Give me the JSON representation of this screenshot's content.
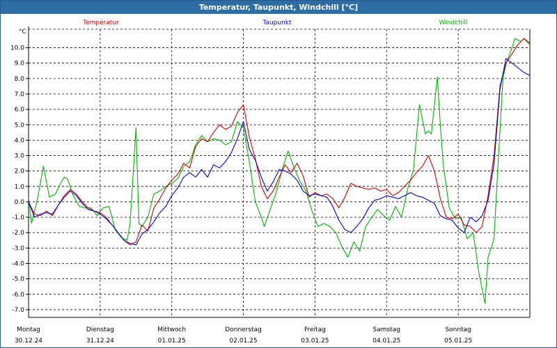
{
  "window": {
    "title": "Temperatur, Taupunkt, Windchill [°C]"
  },
  "chart_data": {
    "type": "line",
    "title": "Temperatur, Taupunkt, Windchill [°C]",
    "ylabel": "°C",
    "ylim": [
      -7.5,
      11.2
    ],
    "yticks": [
      "10.0",
      "9.0",
      "8.0",
      "7.0",
      "6.0",
      "5.0",
      "4.0",
      "3.0",
      "2.0",
      "1.0",
      "0.0",
      "-1.0",
      "-2.0",
      "-3.0",
      "-4.0",
      "-5.0",
      "-6.0",
      "-7.0"
    ],
    "xlim": [
      0,
      168
    ],
    "x_ticks": [
      {
        "x": 0,
        "day": "Montag",
        "date": "30.12.24"
      },
      {
        "x": 24,
        "day": "Dienstag",
        "date": "31.12.24"
      },
      {
        "x": 48,
        "day": "Mittwoch",
        "date": "01.01.25"
      },
      {
        "x": 72,
        "day": "Donnerstag",
        "date": "02.01.25"
      },
      {
        "x": 96,
        "day": "Freitag",
        "date": "03.01.25"
      },
      {
        "x": 120,
        "day": "Samstag",
        "date": "04.01.25"
      },
      {
        "x": 144,
        "day": "Sonntag",
        "date": "05.01.25"
      }
    ],
    "grid": true,
    "series": [
      {
        "name": "Temperatur",
        "color": "#d40000",
        "points": [
          [
            0,
            0.0
          ],
          [
            2,
            -0.8
          ],
          [
            4,
            -0.9
          ],
          [
            6,
            -0.6
          ],
          [
            8,
            -0.9
          ],
          [
            10,
            -0.2
          ],
          [
            12,
            0.4
          ],
          [
            14,
            0.8
          ],
          [
            16,
            0.5
          ],
          [
            18,
            0.0
          ],
          [
            20,
            -0.4
          ],
          [
            22,
            -0.6
          ],
          [
            24,
            -0.7
          ],
          [
            26,
            -1.0
          ],
          [
            28,
            -1.5
          ],
          [
            30,
            -2.0
          ],
          [
            32,
            -2.5
          ],
          [
            34,
            -2.8
          ],
          [
            36,
            -2.6
          ],
          [
            38,
            -1.5
          ],
          [
            40,
            -1.9
          ],
          [
            42,
            -0.4
          ],
          [
            44,
            0.2
          ],
          [
            46,
            0.9
          ],
          [
            48,
            1.4
          ],
          [
            50,
            1.8
          ],
          [
            52,
            2.5
          ],
          [
            54,
            2.2
          ],
          [
            56,
            3.6
          ],
          [
            58,
            4.1
          ],
          [
            60,
            3.9
          ],
          [
            62,
            4.5
          ],
          [
            64,
            5.0
          ],
          [
            66,
            4.7
          ],
          [
            68,
            4.9
          ],
          [
            70,
            5.8
          ],
          [
            72,
            6.3
          ],
          [
            74,
            4.2
          ],
          [
            76,
            2.8
          ],
          [
            78,
            1.0
          ],
          [
            80,
            0.2
          ],
          [
            82,
            0.7
          ],
          [
            84,
            1.6
          ],
          [
            86,
            2.4
          ],
          [
            88,
            1.9
          ],
          [
            90,
            2.5
          ],
          [
            92,
            1.7
          ],
          [
            94,
            0.3
          ],
          [
            96,
            0.6
          ],
          [
            98,
            0.4
          ],
          [
            100,
            0.5
          ],
          [
            102,
            0.2
          ],
          [
            104,
            -0.4
          ],
          [
            106,
            0.3
          ],
          [
            108,
            1.2
          ],
          [
            110,
            1.0
          ],
          [
            112,
            0.9
          ],
          [
            114,
            0.8
          ],
          [
            116,
            0.9
          ],
          [
            118,
            0.7
          ],
          [
            120,
            0.8
          ],
          [
            122,
            0.4
          ],
          [
            124,
            0.6
          ],
          [
            126,
            1.0
          ],
          [
            128,
            1.4
          ],
          [
            130,
            1.9
          ],
          [
            132,
            2.3
          ],
          [
            134,
            3.0
          ],
          [
            136,
            2.0
          ],
          [
            138,
            0.2
          ],
          [
            140,
            -1.0
          ],
          [
            142,
            -1.1
          ],
          [
            144,
            -0.8
          ],
          [
            146,
            -1.5
          ],
          [
            148,
            -1.6
          ],
          [
            150,
            -2.0
          ],
          [
            152,
            -1.6
          ],
          [
            154,
            0.4
          ],
          [
            156,
            3.0
          ],
          [
            158,
            7.5
          ],
          [
            160,
            9.0
          ],
          [
            162,
            9.6
          ],
          [
            164,
            10.2
          ],
          [
            166,
            10.6
          ],
          [
            168,
            10.3
          ]
        ]
      },
      {
        "name": "Taupunkt",
        "color": "#0000c8",
        "points": [
          [
            0,
            0.0
          ],
          [
            2,
            -1.0
          ],
          [
            4,
            -0.8
          ],
          [
            6,
            -0.7
          ],
          [
            8,
            -0.8
          ],
          [
            10,
            -0.2
          ],
          [
            12,
            0.3
          ],
          [
            14,
            0.7
          ],
          [
            16,
            0.4
          ],
          [
            18,
            -0.1
          ],
          [
            20,
            -0.5
          ],
          [
            22,
            -0.6
          ],
          [
            24,
            -0.8
          ],
          [
            26,
            -1.1
          ],
          [
            28,
            -1.5
          ],
          [
            30,
            -2.0
          ],
          [
            32,
            -2.5
          ],
          [
            34,
            -2.7
          ],
          [
            36,
            -2.8
          ],
          [
            38,
            -2.1
          ],
          [
            40,
            -1.8
          ],
          [
            42,
            -1.3
          ],
          [
            44,
            -0.7
          ],
          [
            46,
            -0.3
          ],
          [
            48,
            0.4
          ],
          [
            50,
            0.9
          ],
          [
            52,
            1.6
          ],
          [
            54,
            1.9
          ],
          [
            56,
            1.6
          ],
          [
            58,
            2.1
          ],
          [
            60,
            1.6
          ],
          [
            62,
            2.4
          ],
          [
            64,
            2.2
          ],
          [
            66,
            2.6
          ],
          [
            68,
            3.2
          ],
          [
            70,
            4.1
          ],
          [
            72,
            5.2
          ],
          [
            74,
            3.4
          ],
          [
            76,
            2.7
          ],
          [
            78,
            1.6
          ],
          [
            80,
            0.7
          ],
          [
            82,
            1.3
          ],
          [
            84,
            2.1
          ],
          [
            86,
            2.0
          ],
          [
            88,
            1.8
          ],
          [
            90,
            1.4
          ],
          [
            92,
            0.7
          ],
          [
            94,
            0.4
          ],
          [
            96,
            0.5
          ],
          [
            98,
            0.4
          ],
          [
            100,
            0.3
          ],
          [
            102,
            -0.3
          ],
          [
            104,
            -1.2
          ],
          [
            106,
            -1.8
          ],
          [
            108,
            -2.0
          ],
          [
            110,
            -1.6
          ],
          [
            112,
            -1.1
          ],
          [
            114,
            -0.4
          ],
          [
            116,
            0.1
          ],
          [
            118,
            0.2
          ],
          [
            120,
            0.4
          ],
          [
            122,
            0.3
          ],
          [
            124,
            0.2
          ],
          [
            126,
            0.4
          ],
          [
            128,
            0.6
          ],
          [
            130,
            0.4
          ],
          [
            132,
            0.3
          ],
          [
            134,
            0.1
          ],
          [
            136,
            -0.1
          ],
          [
            138,
            -0.9
          ],
          [
            140,
            -1.1
          ],
          [
            142,
            -1.2
          ],
          [
            144,
            -1.7
          ],
          [
            146,
            -2.0
          ],
          [
            148,
            -1.0
          ],
          [
            150,
            -1.3
          ],
          [
            152,
            -0.9
          ],
          [
            154,
            0.1
          ],
          [
            156,
            2.5
          ],
          [
            158,
            7.3
          ],
          [
            160,
            9.3
          ],
          [
            162,
            9.0
          ],
          [
            164,
            8.7
          ],
          [
            166,
            8.4
          ],
          [
            168,
            8.2
          ]
        ]
      },
      {
        "name": "Windchill",
        "color": "#00b400",
        "points": [
          [
            0,
            0.3
          ],
          [
            1,
            -1.4
          ],
          [
            3,
            0.2
          ],
          [
            5,
            2.3
          ],
          [
            7,
            0.3
          ],
          [
            9,
            0.5
          ],
          [
            11,
            1.3
          ],
          [
            12,
            1.6
          ],
          [
            13,
            1.5
          ],
          [
            15,
            0.4
          ],
          [
            17,
            -0.3
          ],
          [
            19,
            -0.4
          ],
          [
            21,
            -0.4
          ],
          [
            23,
            -0.9
          ],
          [
            25,
            -0.4
          ],
          [
            27,
            -0.3
          ],
          [
            29,
            -1.8
          ],
          [
            31,
            -2.3
          ],
          [
            33,
            -2.5
          ],
          [
            34,
            -1.5
          ],
          [
            35,
            1.6
          ],
          [
            36,
            4.8
          ],
          [
            37,
            -1.4
          ],
          [
            38,
            -1.6
          ],
          [
            40,
            -1.0
          ],
          [
            42,
            0.5
          ],
          [
            44,
            0.7
          ],
          [
            46,
            1.0
          ],
          [
            48,
            1.2
          ],
          [
            50,
            1.5
          ],
          [
            52,
            2.3
          ],
          [
            54,
            2.6
          ],
          [
            56,
            3.7
          ],
          [
            58,
            4.3
          ],
          [
            60,
            3.9
          ],
          [
            62,
            4.1
          ],
          [
            64,
            4.0
          ],
          [
            66,
            3.7
          ],
          [
            68,
            3.9
          ],
          [
            70,
            5.2
          ],
          [
            72,
            4.8
          ],
          [
            74,
            2.6
          ],
          [
            76,
            0.0
          ],
          [
            78,
            -1.0
          ],
          [
            79,
            -1.6
          ],
          [
            81,
            -0.5
          ],
          [
            83,
            0.6
          ],
          [
            85,
            2.1
          ],
          [
            87,
            3.3
          ],
          [
            89,
            2.2
          ],
          [
            91,
            1.3
          ],
          [
            93,
            0.7
          ],
          [
            95,
            -0.6
          ],
          [
            97,
            -1.6
          ],
          [
            99,
            -1.4
          ],
          [
            101,
            -1.6
          ],
          [
            103,
            -2.0
          ],
          [
            105,
            -2.9
          ],
          [
            107,
            -3.6
          ],
          [
            109,
            -2.6
          ],
          [
            111,
            -3.2
          ],
          [
            113,
            -1.6
          ],
          [
            115,
            -1.0
          ],
          [
            117,
            -0.5
          ],
          [
            119,
            -0.9
          ],
          [
            121,
            -1.2
          ],
          [
            123,
            -0.3
          ],
          [
            125,
            -1.0
          ],
          [
            127,
            0.8
          ],
          [
            129,
            2.1
          ],
          [
            131,
            6.3
          ],
          [
            133,
            4.4
          ],
          [
            134,
            4.6
          ],
          [
            135,
            4.4
          ],
          [
            137,
            8.1
          ],
          [
            138,
            5.0
          ],
          [
            139,
            2.4
          ],
          [
            141,
            -0.4
          ],
          [
            143,
            -1.1
          ],
          [
            145,
            -1.0
          ],
          [
            147,
            -2.4
          ],
          [
            149,
            -2.0
          ],
          [
            151,
            -4.7
          ],
          [
            153,
            -6.6
          ],
          [
            154,
            -3.6
          ],
          [
            156,
            -2.4
          ],
          [
            157,
            1.3
          ],
          [
            159,
            8.0
          ],
          [
            160,
            8.9
          ],
          [
            162,
            10.0
          ],
          [
            163,
            10.6
          ],
          [
            165,
            10.4
          ],
          [
            166,
            10.6
          ],
          [
            168,
            10.2
          ]
        ]
      }
    ]
  }
}
